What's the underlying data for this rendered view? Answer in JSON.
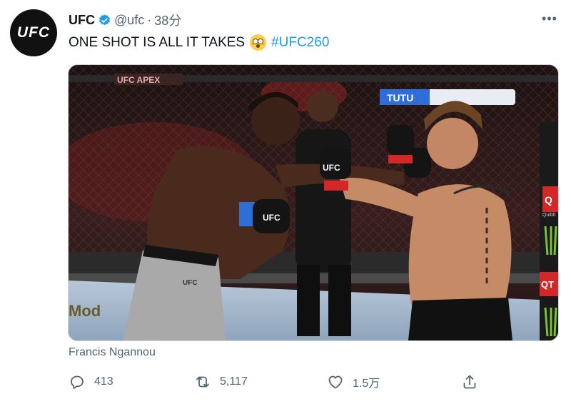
{
  "tweet": {
    "author": {
      "display_name": "UFC",
      "handle": "@ufc",
      "separator": "·",
      "time": "38分",
      "avatar_text": "UFC",
      "verified": true
    },
    "text": "ONE SHOT IS ALL IT TAKES",
    "emoji": "flushed-face",
    "hashtag": "#UFC260",
    "media": {
      "signage": {
        "apex": "UFC APEX",
        "banner": "TUTU",
        "glove_logo": "UFC",
        "shorts_logo": "UFC",
        "sponsor_q": "Q",
        "sponsor_q_sub": "Quiblt",
        "sponsor_qt": "QT",
        "floor": "Mod"
      }
    },
    "caption": "Francis Ngannou",
    "stats": {
      "replies": "413",
      "retweets": "5,117",
      "likes": "1.5万"
    }
  },
  "icons": {
    "verified": "verified-badge-icon",
    "more": "more-icon",
    "reply": "reply-icon",
    "retweet": "retweet-icon",
    "like": "heart-icon",
    "share": "share-icon"
  },
  "colors": {
    "accent": "#1d9bf0",
    "secondary_text": "#536471",
    "primary_text": "#0f1419"
  }
}
